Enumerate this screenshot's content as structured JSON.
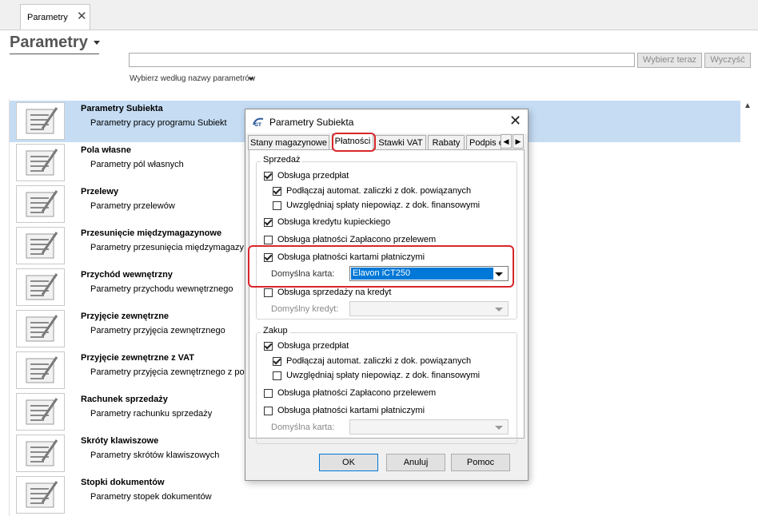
{
  "window_tab": {
    "label": "Parametry",
    "close_glyph": "✕"
  },
  "header": {
    "title": "Parametry",
    "search_value": "",
    "select_now_label": "Wybierz teraz",
    "clear_label": "Wyczyść",
    "search_hint": "Wybierz według nazwy parametrów"
  },
  "list": {
    "items": [
      {
        "title": "Parametry Subiekta",
        "desc": "Parametry pracy programu Subiekt",
        "selected": true
      },
      {
        "title": "Pola własne",
        "desc": "Parametry pól własnych"
      },
      {
        "title": "Przelewy",
        "desc": "Parametry przelewów"
      },
      {
        "title": "Przesunięcie międzymagazynowe",
        "desc": "Parametry przesunięcia międzymagazy"
      },
      {
        "title": "Przychód wewnętrzny",
        "desc": "Parametry przychodu wewnętrznego"
      },
      {
        "title": "Przyjęcie zewnętrzne",
        "desc": "Parametry przyjęcia zewnętrznego"
      },
      {
        "title": "Przyjęcie zewnętrzne z VAT",
        "desc": "Parametry przyjęcia zewnętrznego z po"
      },
      {
        "title": "Rachunek sprzedaży",
        "desc": "Parametry rachunku sprzedaży"
      },
      {
        "title": "Skróty klawiszowe",
        "desc": "Parametry skrótów klawiszowych"
      },
      {
        "title": "Stopki dokumentów",
        "desc": "Parametry stopek dokumentów"
      }
    ]
  },
  "dialog": {
    "title": "Parametry Subiekta",
    "close_glyph": "✕",
    "tabs": [
      "Stany magazynowe",
      "Płatności",
      "Stawki VAT",
      "Rabaty",
      "Podpis e"
    ],
    "active_tab": "Płatności",
    "tab_scroll_left": "◀",
    "tab_scroll_right": "▶",
    "sales": {
      "legend": "Sprzedaż",
      "prepayments": "Obsługa przedpłat",
      "auto_link": "Podłączaj automat. zaliczki z dok. powiązanych",
      "include_unlinked": "Uwzględniaj spłaty niepowiąz. z dok. finansowymi",
      "merchant_credit": "Obsługa kredytu kupieckiego",
      "transfer_paid": "Obsługa płatności Zapłacono przelewem",
      "card_payments": "Obsługa płatności kartami płatniczymi",
      "default_card_label": "Domyślna karta:",
      "default_card_value": "Elavon iCT250",
      "credit_sales": "Obsługa sprzedaży na kredyt",
      "default_credit_label": "Domyślny kredyt:"
    },
    "purchase": {
      "legend": "Zakup",
      "prepayments": "Obsługa przedpłat",
      "auto_link": "Podłączaj automat. zaliczki z dok. powiązanych",
      "include_unlinked": "Uwzględniaj spłaty niepowiąz. z dok. finansowymi",
      "transfer_paid": "Obsługa płatności Zapłacono przelewem",
      "card_payments": "Obsługa płatności kartami płatniczymi",
      "default_card_label": "Domyślna karta:"
    },
    "buttons": {
      "ok": "OK",
      "cancel": "Anuluj",
      "help": "Pomoc"
    }
  },
  "colors": {
    "selection": "#c5dcf3",
    "highlight": "#d9262a",
    "combo_selection": "#0078d7"
  }
}
